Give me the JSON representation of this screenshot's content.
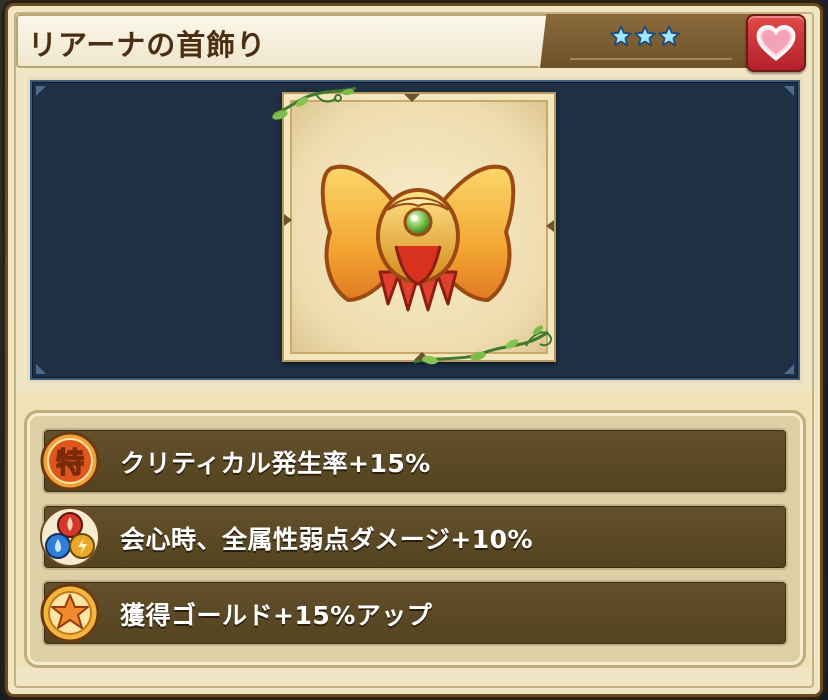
{
  "item": {
    "name": "リアーナの首飾り",
    "rarity_stars": 3,
    "favorite": true
  },
  "icons": {
    "favorite": "heart-icon",
    "rarity": "star-icon",
    "item_art": "bow-necklace-icon",
    "skill_1": "special-kanji-icon",
    "skill_2": "element-orbs-icon",
    "skill_3": "star-medal-icon"
  },
  "skills": [
    {
      "label": "クリティカル発生率+15%",
      "icon_text": "特"
    },
    {
      "label": "会心時、全属性弱点ダメージ+10%"
    },
    {
      "label": "獲得ゴールド+15%アップ"
    }
  ],
  "colors": {
    "title_text": "#4a2f14",
    "favorite_button": "#c52c34",
    "star": "#8ee0ff",
    "panel": "#1f3044",
    "skill_row": "#5c4826"
  }
}
